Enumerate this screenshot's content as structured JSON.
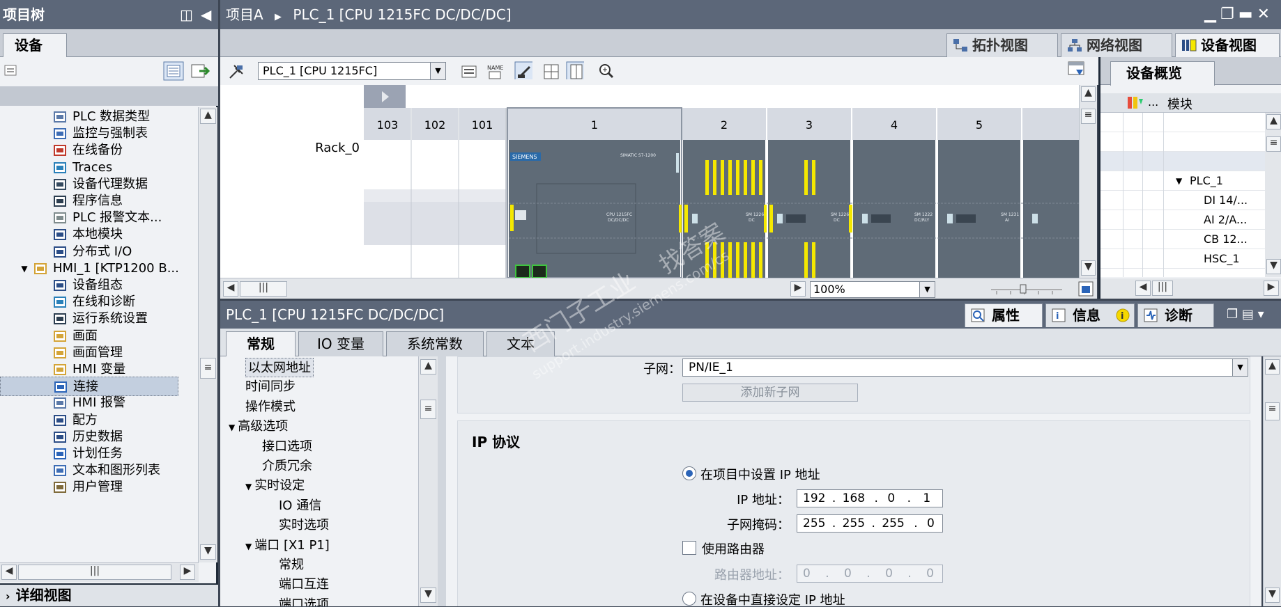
{
  "project_tree": {
    "title": "项目树",
    "tab": "设备",
    "items": [
      {
        "label": "PLC 数据类型",
        "icon": "plc-datatype-icon",
        "arrow": "▶"
      },
      {
        "label": "监控与强制表",
        "icon": "watch-table-icon",
        "arrow": "▶"
      },
      {
        "label": "在线备份",
        "icon": "online-backup-icon",
        "arrow": "▶"
      },
      {
        "label": "Traces",
        "icon": "trace-icon",
        "arrow": "▶"
      },
      {
        "label": "设备代理数据",
        "icon": "device-proxy-icon",
        "arrow": "▶"
      },
      {
        "label": "程序信息",
        "icon": "program-info-icon",
        "arrow": ""
      },
      {
        "label": "PLC 报警文本...",
        "icon": "alarm-text-icon",
        "arrow": ""
      },
      {
        "label": "本地模块",
        "icon": "local-modules-icon",
        "arrow": "▶"
      },
      {
        "label": "分布式 I/O",
        "icon": "distributed-io-icon",
        "arrow": "▶"
      },
      {
        "label": "HMI_1 [KTP1200 B...",
        "icon": "hmi-folder-icon",
        "arrow": "▼"
      },
      {
        "label": "设备组态",
        "icon": "device-config-icon",
        "arrow": ""
      },
      {
        "label": "在线和诊断",
        "icon": "online-diagnostics-icon",
        "arrow": ""
      },
      {
        "label": "运行系统设置",
        "icon": "runtime-settings-icon",
        "arrow": ""
      },
      {
        "label": "画面",
        "icon": "screens-icon",
        "arrow": "▶"
      },
      {
        "label": "画面管理",
        "icon": "screen-management-icon",
        "arrow": "▶"
      },
      {
        "label": "HMI 变量",
        "icon": "hmi-tags-icon",
        "arrow": "▶"
      },
      {
        "label": "连接",
        "icon": "connections-icon",
        "arrow": ""
      },
      {
        "label": "HMI 报警",
        "icon": "hmi-alarms-icon",
        "arrow": ""
      },
      {
        "label": "配方",
        "icon": "recipes-icon",
        "arrow": ""
      },
      {
        "label": "历史数据",
        "icon": "historical-data-icon",
        "arrow": ""
      },
      {
        "label": "计划任务",
        "icon": "scheduled-tasks-icon",
        "arrow": ""
      },
      {
        "label": "文本和图形列表",
        "icon": "text-graphic-lists-icon",
        "arrow": ""
      },
      {
        "label": "用户管理",
        "icon": "user-admin-icon",
        "arrow": ""
      }
    ],
    "detail_view": "详细视图"
  },
  "header": {
    "breadcrumb_project": "项目A",
    "breadcrumb_sep": "▶",
    "breadcrumb_device": "PLC_1 [CPU 1215FC DC/DC/DC]",
    "view_tabs": [
      "拓扑视图",
      "网络视图",
      "设备视图"
    ],
    "active_view": "设备视图"
  },
  "device_view": {
    "device_select": "PLC_1 [CPU 1215FC]",
    "rack_label": "Rack_0",
    "slots": [
      "103",
      "102",
      "101",
      "1",
      "2",
      "3",
      "4",
      "5"
    ],
    "zoom": "100%",
    "module_text": {
      "brand": "SIEMENS",
      "cpu_series": "SIMATIC S7-1200",
      "cpu_name": "CPU 1215FC\nDC/DC/DC",
      "sm_dc": "SM 1226\nDC",
      "sm_relay": "SM 1222\nDC/RLY",
      "sm_ai": "SM 1231\nAI"
    }
  },
  "device_overview": {
    "tab": "设备概览",
    "col_dots": "...",
    "col_module": "模块",
    "rows": [
      "PLC_1",
      "DI 14/...",
      "AI 2/A...",
      "CB 12...",
      "HSC_1"
    ]
  },
  "properties": {
    "title": "PLC_1 [CPU 1215FC DC/DC/DC]",
    "panel_tabs": [
      "属性",
      "信息",
      "诊断"
    ],
    "sub_tabs": [
      "常规",
      "IO 变量",
      "系统常数",
      "文本"
    ],
    "nav": [
      {
        "label": "以太网地址",
        "level": 0,
        "arrow": "",
        "selected": true
      },
      {
        "label": "时间同步",
        "level": 0,
        "arrow": ""
      },
      {
        "label": "操作模式",
        "level": 0,
        "arrow": ""
      },
      {
        "label": "高级选项",
        "level": 0,
        "arrow": "▼"
      },
      {
        "label": "接口选项",
        "level": 1,
        "arrow": ""
      },
      {
        "label": "介质冗余",
        "level": 1,
        "arrow": ""
      },
      {
        "label": "实时设定",
        "level": 1,
        "arrow": "▼"
      },
      {
        "label": "IO 通信",
        "level": 2,
        "arrow": ""
      },
      {
        "label": "实时选项",
        "level": 2,
        "arrow": ""
      },
      {
        "label": "端口 [X1 P1]",
        "level": 1,
        "arrow": "▼"
      },
      {
        "label": "常规",
        "level": 2,
        "arrow": ""
      },
      {
        "label": "端口互连",
        "level": 2,
        "arrow": ""
      },
      {
        "label": "端口选项",
        "level": 2,
        "arrow": ""
      }
    ],
    "subnet_label": "子网：",
    "subnet_value": "PN/IE_1",
    "add_subnet_button": "添加新子网",
    "ip_section_title": "IP 协议",
    "set_ip_in_project": "在项目中设置 IP 地址",
    "ip_label": "IP 地址：",
    "ip_octets": [
      "192",
      "168",
      "0",
      "1"
    ],
    "mask_label": "子网掩码：",
    "mask_octets": [
      "255",
      "255",
      "255",
      "0"
    ],
    "use_router": "使用路由器",
    "router_label": "路由器地址：",
    "router_octets": [
      "0",
      "0",
      "0",
      "0"
    ],
    "set_ip_on_device": "在设备中直接设定 IP 地址",
    "octet_sep": "."
  },
  "watermark": {
    "line1": "找答案",
    "line2": "西门子工业",
    "line3": "support.industry.siemens.com/cs"
  },
  "colors": {
    "title_bar": "#5c6779",
    "rack_module": "#5f6b77",
    "io_highlight": "#f5e800",
    "selection": "#c3cfdf",
    "radio_dot": "#2b64b8"
  }
}
